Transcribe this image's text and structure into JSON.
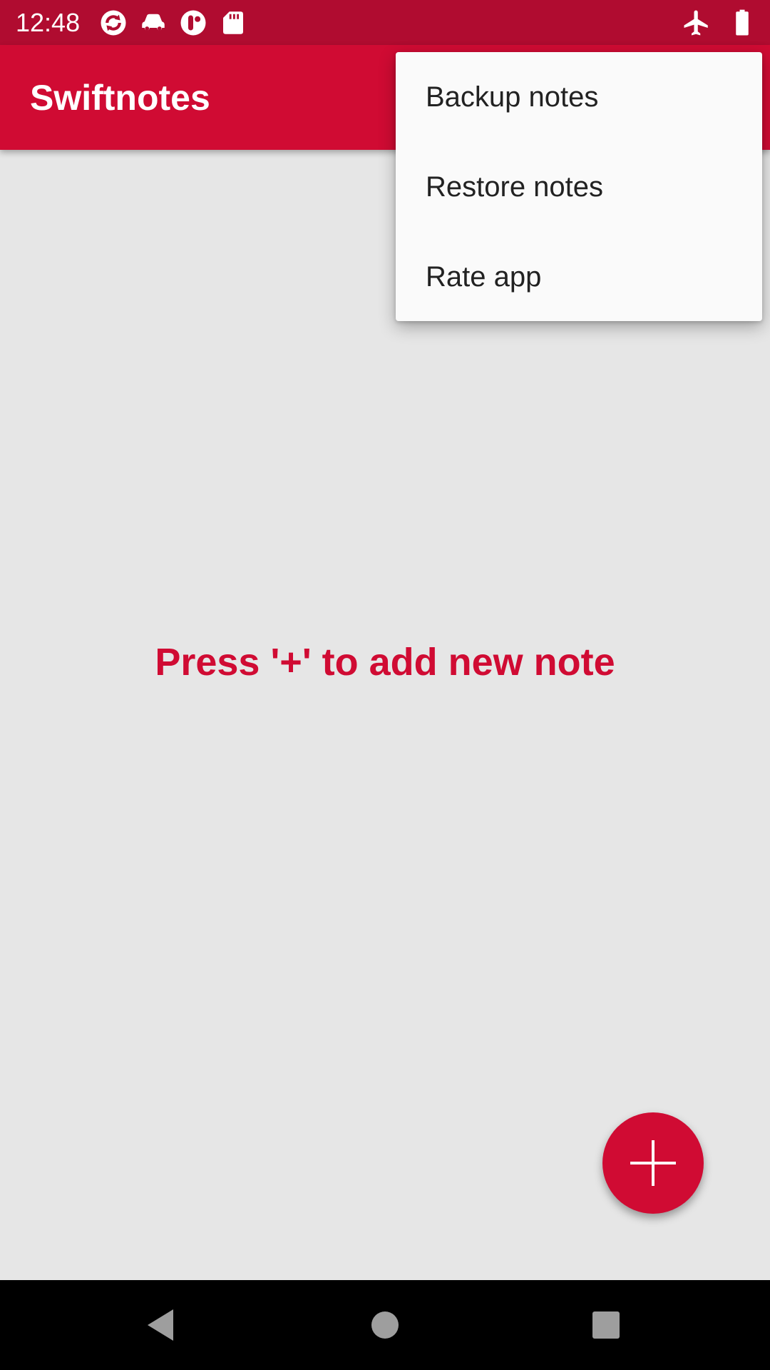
{
  "status_bar": {
    "time": "12:48",
    "left_icons": [
      "sync-icon",
      "car-icon",
      "account-icon",
      "sd-card-icon"
    ],
    "right_icons": [
      "airplane-mode-icon",
      "battery-icon"
    ],
    "color": "#b00c30"
  },
  "app_bar": {
    "title": "Swiftnotes",
    "color": "#d00b33"
  },
  "overflow_menu": {
    "items": [
      {
        "label": "Backup notes"
      },
      {
        "label": "Restore notes"
      },
      {
        "label": "Rate app"
      }
    ]
  },
  "empty_state": {
    "message": "Press '+' to add new note",
    "color": "#d00b33"
  },
  "fab": {
    "icon": "plus-icon",
    "color": "#d00b33"
  },
  "nav_bar": {
    "buttons": [
      "back-icon",
      "home-icon",
      "recents-icon"
    ]
  }
}
